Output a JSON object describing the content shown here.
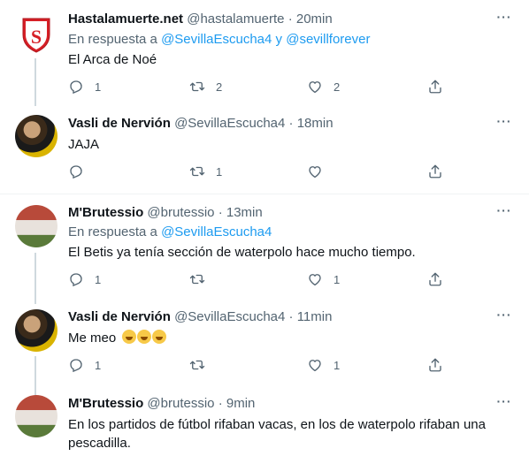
{
  "tweets": [
    {
      "name": "Hastalamuerte.net",
      "handle": "@hastalamuerte",
      "sep": "·",
      "time": "20min",
      "reply_prefix": "En respuesta a",
      "reply_users": [
        "@SevillaEscucha4",
        "y",
        "@sevillforever"
      ],
      "text": "El Arca de Noé",
      "reply_count": "1",
      "retweet_count": "2",
      "like_count": "2",
      "avatar": "sevilla-crest-icon"
    },
    {
      "name": "Vasli de Nervión",
      "handle": "@SevillaEscucha4",
      "sep": "·",
      "time": "18min",
      "text": "JAJA",
      "reply_count": "",
      "retweet_count": "1",
      "like_count": "",
      "avatar": "player-photo-avatar"
    },
    {
      "name": "M'Brutessio",
      "handle": "@brutessio",
      "sep": "·",
      "time": "13min",
      "reply_prefix": "En respuesta a",
      "reply_users": [
        "@SevillaEscucha4"
      ],
      "text": "El Betis ya tenía sección de waterpolo hace mucho tiempo.",
      "reply_count": "1",
      "retweet_count": "",
      "like_count": "1",
      "avatar": "stadium-photo-avatar"
    },
    {
      "name": "Vasli de Nervión",
      "handle": "@SevillaEscucha4",
      "sep": "·",
      "time": "11min",
      "text": "Me meo",
      "emojis": "🤣🤣🤣",
      "reply_count": "1",
      "retweet_count": "",
      "like_count": "1",
      "avatar": "player-photo-avatar"
    },
    {
      "name": "M'Brutessio",
      "handle": "@brutessio",
      "sep": "·",
      "time": "9min",
      "text": "En los partidos de fútbol rifaban vacas, en los de waterpolo rifaban una pescadilla.",
      "avatar": "stadium-photo-avatar"
    }
  ],
  "colors": {
    "link": "#1d9bf0",
    "secondary": "#536471",
    "divider": "#eff3f4",
    "thread_line": "#cfd9de"
  }
}
